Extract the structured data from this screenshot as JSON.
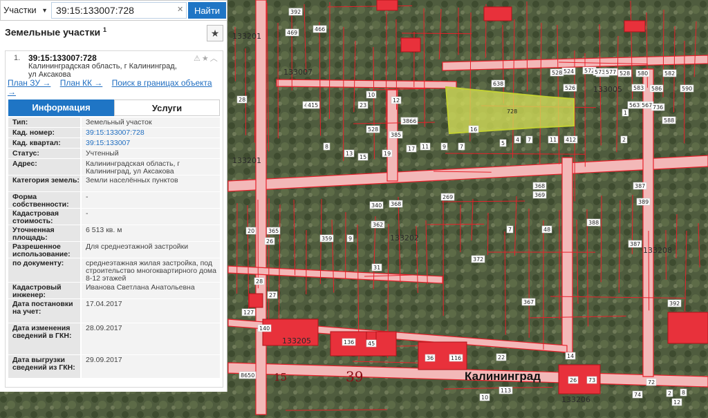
{
  "search": {
    "type_label": "Участки",
    "query": "39:15:133007:728",
    "button_label": "Найти"
  },
  "panel": {
    "title": "Земельные участки",
    "title_count": "1"
  },
  "card": {
    "index": "1.",
    "kad_number": "39:15:133007:728",
    "address": "Калининградская область, г Калининград, ул Аксакова",
    "links": {
      "plan_zu": "План ЗУ →",
      "plan_kk": "План КК →",
      "search_bounds": "Поиск в границах объекта →"
    }
  },
  "tabs": {
    "info": "Информация",
    "services": "Услуги"
  },
  "attributes": [
    {
      "key": "Тип:",
      "value": "Земельный участок"
    },
    {
      "key": "Кад. номер:",
      "value": "39:15:133007:728"
    },
    {
      "key": "Кад. квартал:",
      "value": "39:15:133007"
    },
    {
      "key": "Статус:",
      "value": "Учтенный"
    },
    {
      "key": "Адрес:",
      "value": "Калининградская область, г Калининград, ул Аксакова"
    },
    {
      "key": "Категория земель:",
      "value": "Земли населённых пунктов"
    },
    {
      "key": "Форма собственности:",
      "value": "-"
    },
    {
      "key": "Кадастровая стоимость:",
      "value": "-"
    },
    {
      "key": "Уточненная площадь:",
      "value": "6 513 кв. м"
    },
    {
      "key": "Разрешенное использование:",
      "value": "Для среднеэтажной застройки"
    },
    {
      "key": "по документу:",
      "value": "среднеэтажная жилая застройка, под строительство многоквартирного дома 8-12 этажей"
    },
    {
      "key": "Кадастровый инженер:",
      "value": "Иванова Светлана Анатольевна"
    },
    {
      "key": "Дата постановки на учет:",
      "value": "17.04.2017"
    },
    {
      "key": "Дата изменения сведений в ГКН:",
      "value": "28.09.2017"
    },
    {
      "key": "Дата выгрузки сведений из ГКН:",
      "value": "29.09.2017"
    }
  ],
  "map": {
    "highlight_color": "#d8e35a",
    "boundary_color": "#e8202a",
    "city_label": "Калининград",
    "road_labels": [
      "39",
      "15"
    ],
    "selected_plot_label": "728",
    "block_labels": [
      "133007",
      "133005",
      "133202",
      "133208",
      "133201",
      "133205",
      "133206",
      "133201"
    ],
    "plot_labels": [
      "464",
      "469",
      "466",
      "415",
      "10",
      "12",
      "3866",
      "528",
      "528",
      "524",
      "526",
      "638",
      "530",
      "528",
      "583",
      "586",
      "590",
      "572",
      "573",
      "577",
      "580",
      "582",
      "563",
      "567",
      "736",
      "588",
      "1",
      "2",
      "7",
      "4",
      "16",
      "5",
      "11",
      "412",
      "28",
      "415",
      "23",
      "385",
      "8",
      "13",
      "15",
      "19",
      "17",
      "11",
      "9",
      "7",
      "369",
      "368",
      "387",
      "389",
      "269",
      "340",
      "362",
      "368",
      "7",
      "48",
      "388",
      "387",
      "365",
      "20",
      "26",
      "359",
      "9",
      "372",
      "31",
      "28",
      "27",
      "367",
      "392",
      "127",
      "140",
      "136",
      "45",
      "36",
      "116",
      "26",
      "73",
      "72",
      "74",
      "2",
      "8",
      "12",
      "8650",
      "113",
      "10",
      "14",
      "22",
      "392"
    ]
  }
}
